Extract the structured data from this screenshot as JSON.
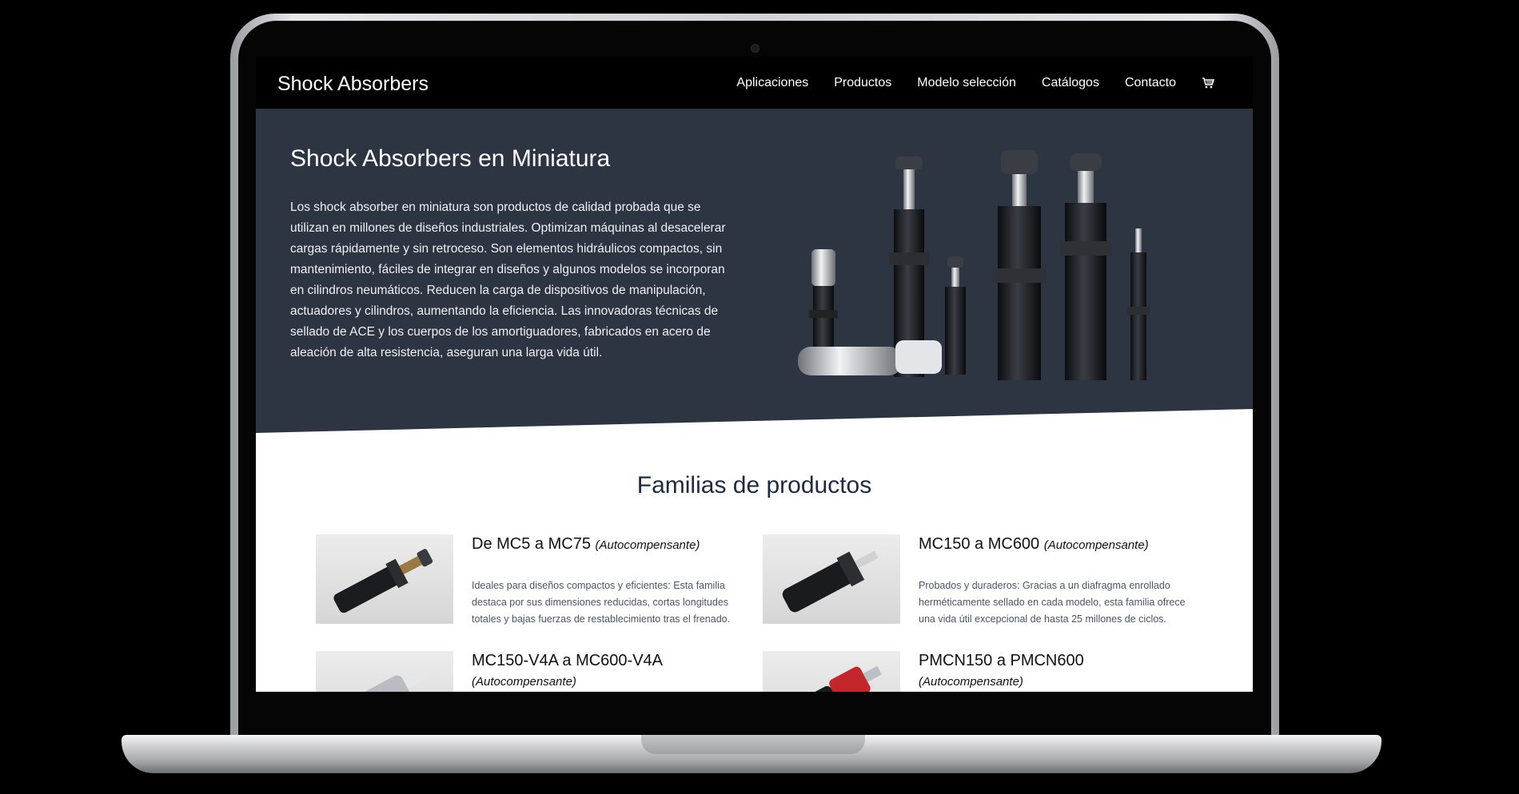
{
  "site": {
    "brand": "Shock Absorbers",
    "nav": [
      "Aplicaciones",
      "Productos",
      "Modelo selección",
      "Catálogos",
      "Contacto"
    ],
    "cart_icon": "cart-icon"
  },
  "hero": {
    "title": "Shock Absorbers en Miniatura",
    "text": "Los shock absorber en miniatura son productos de calidad probada que se utilizan en millones de diseños industriales. Optimizan máquinas al desacelerar cargas rápidamente y sin retroceso. Son elementos hidráulicos compactos, sin mantenimiento, fáciles de integrar en diseños y algunos modelos se incorporan en cilindros neumáticos. Reducen la carga de dispositivos de manipulación, actuadores y cilindros, aumentando la eficiencia. Las innovadoras técnicas de sellado de ACE y los cuerpos de los amortiguadores, fabricados en acero de aleación de alta resistencia, aseguran una larga vida útil.",
    "background": "#2d3442"
  },
  "families": {
    "title": "Familias de productos",
    "items": [
      {
        "name": "De MC5 a MC75",
        "tag": "(Autocompensante)",
        "desc": "Ideales para diseños compactos y eficientes: Esta familia destaca por sus dimensiones reducidas, cortas longitudes totales y bajas fuerzas de restablecimiento tras el frenado."
      },
      {
        "name": "MC150 a MC600",
        "tag": "(Autocompensante)",
        "desc": "Probados y duraderos: Gracias a un diafragma enrollado herméticamente sellado en cada modelo, esta familia ofrece una vida útil excepcional de hasta 25 millones de ciclos."
      },
      {
        "name": "MC150-V4A a MC600-V4A",
        "tag": "(Autocompensante)",
        "desc": ""
      },
      {
        "name": "PMCN150 a PMCN600",
        "tag": "(Autocompensante)",
        "desc": ""
      }
    ]
  }
}
